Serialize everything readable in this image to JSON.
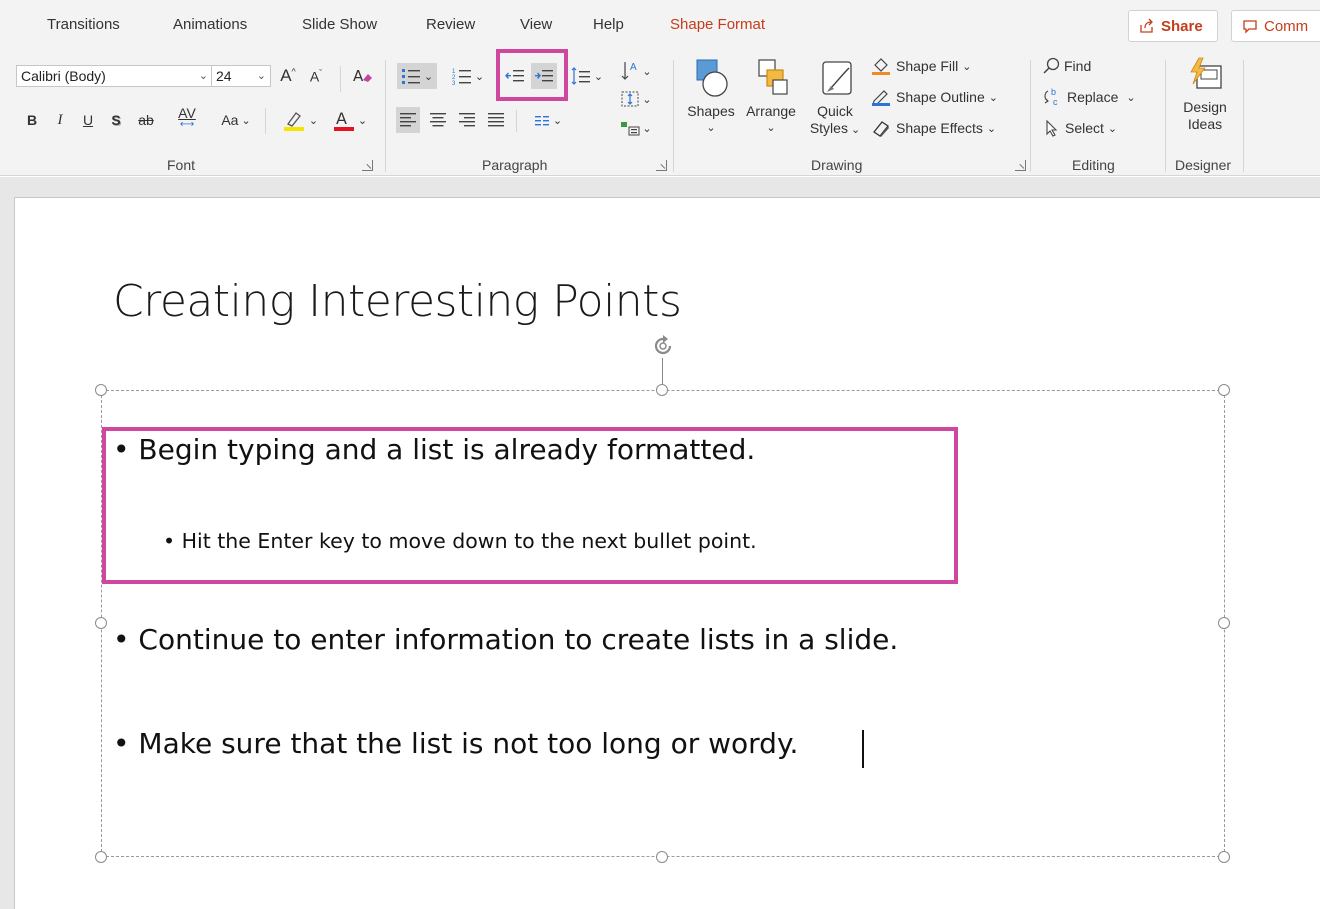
{
  "tabs": [
    {
      "id": "transitions",
      "label": "Transitions"
    },
    {
      "id": "animations",
      "label": "Animations"
    },
    {
      "id": "slideshow",
      "label": "Slide Show"
    },
    {
      "id": "review",
      "label": "Review"
    },
    {
      "id": "view",
      "label": "View"
    },
    {
      "id": "help",
      "label": "Help"
    },
    {
      "id": "shapeformat",
      "label": "Shape Format"
    }
  ],
  "share_label": "Share",
  "comment_label": "Comm",
  "font": {
    "group_label": "Font",
    "name": "Calibri (Body)",
    "size": "24",
    "bold": "B",
    "italic": "I",
    "underline": "U",
    "shadow": "S",
    "strike": "ab",
    "spacing": "AV",
    "case": "Aa"
  },
  "paragraph": {
    "group_label": "Paragraph"
  },
  "drawing": {
    "group_label": "Drawing",
    "shapes_label": "Shapes",
    "arrange_label": "Arrange",
    "quick_label": "Quick",
    "styles_label": "Styles",
    "fill_label": "Shape Fill",
    "outline_label": "Shape Outline",
    "effects_label": "Shape Effects"
  },
  "editing": {
    "group_label": "Editing",
    "find_label": "Find",
    "replace_label": "Replace",
    "select_label": "Select"
  },
  "designer": {
    "group_label": "Designer",
    "design_label": "Design",
    "ideas_label": "Ideas"
  },
  "slide": {
    "title": "Creating Interesting Points",
    "bullets": [
      "Begin typing and a list is already formatted.",
      "Hit the Enter key to move down to the next bullet point.",
      "Continue to enter information to create lists in a slide.",
      "Make sure that the list is not too long or wordy."
    ]
  },
  "colors": {
    "accent": "#c43e1c",
    "highlight_frame": "#d0479f",
    "highlighter_yellow": "#f5e600",
    "font_color_red": "#e81123",
    "fill_orange": "#f08a24",
    "outline_blue": "#2b74d8"
  }
}
